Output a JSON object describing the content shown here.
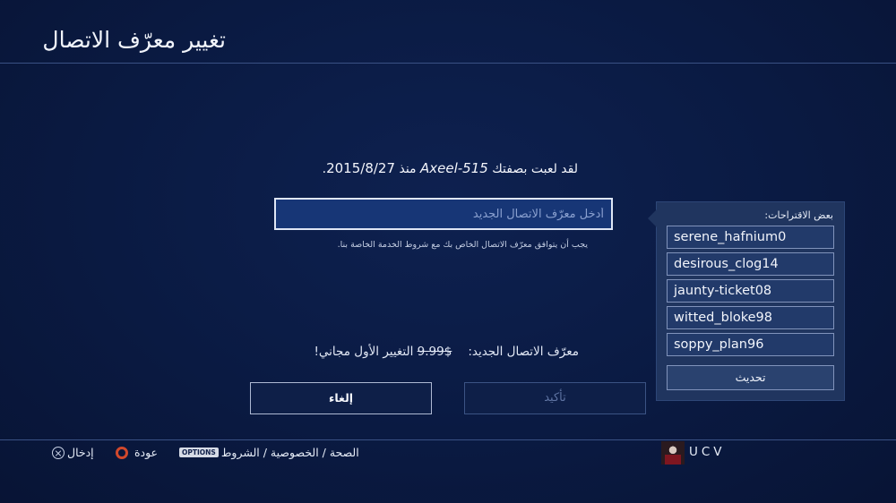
{
  "header": {
    "title": "تغيير معرّف الاتصال"
  },
  "main": {
    "played_prefix": "لقد لعبت بصفتك ",
    "played_name": "Axeel-515",
    "played_middle": " منذ ",
    "played_date": "2015/8/27",
    "played_suffix": ".",
    "input_placeholder": "أدخل معرّف الاتصال الجديد",
    "input_value": "",
    "terms_note": "يجب أن يتوافق معرّف الاتصال الخاص بك مع شروط الخدمة الخاصة بنا.",
    "price_label": "معرّف الاتصال الجديد:",
    "price_old": "$9.99",
    "price_free": "التغيير الأول مجاني!"
  },
  "suggestions": {
    "title": "بعض الاقتراحات:",
    "items": [
      "serene_hafnium0",
      "desirous_clog14",
      "jaunty-ticket08",
      "witted_bloke98",
      "soppy_plan96"
    ],
    "refresh_label": "تحديث"
  },
  "buttons": {
    "cancel_label": "إلغاء",
    "confirm_label": "تأكيد"
  },
  "footer": {
    "enter_label": "إدخال",
    "back_label": "عودة",
    "options_badge": "OPTIONS",
    "options_label": "الصحة / الخصوصية / الشروط",
    "user_name": "UCV"
  },
  "colors": {
    "background": "#0a1a42",
    "input_fill": "#173676",
    "panel": "#20355f",
    "circle_button": "#d1482c"
  }
}
